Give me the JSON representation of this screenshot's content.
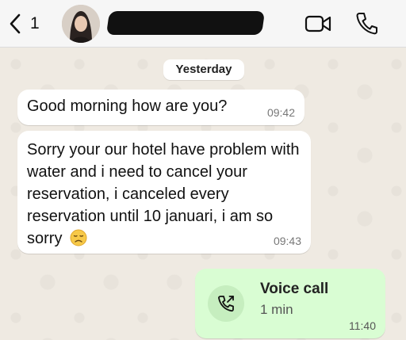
{
  "header": {
    "back_count": "1",
    "icons": [
      "chevron-left-icon",
      "avatar",
      "video-call-icon",
      "phone-icon"
    ]
  },
  "chat": {
    "date_chip": "Yesterday",
    "messages": [
      {
        "type": "incoming",
        "text": "Good morning how are you?",
        "time": "09:42"
      },
      {
        "type": "incoming",
        "text": "Sorry your our hotel have problem with water and i need to cancel your reservation, i canceled every reservation until 10 januari, i am so sorry",
        "emoji": "disappointed-face-icon",
        "time": "09:43"
      },
      {
        "type": "outgoing_call",
        "title": "Voice call",
        "duration": "1 min",
        "time": "11:40"
      }
    ]
  },
  "colors": {
    "chat_bg": "#efeae2",
    "outgoing_bubble": "#d9fdd3",
    "incoming_bubble": "#ffffff"
  }
}
